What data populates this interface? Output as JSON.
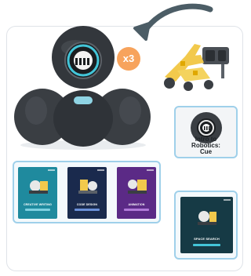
{
  "badge": {
    "text": "x3"
  },
  "intro_card": {
    "label_line1": "Intro to",
    "label_line2": "Robotics:",
    "label_line3": "Cue"
  },
  "book_titles": [
    "CREATIVE WRITING",
    "CODE DESIGN",
    "ANIMATION"
  ],
  "single_book_title": "SPACE SEARCH",
  "colors": {
    "arrow": "#4c5d66",
    "badge": "#f7a35c",
    "card_border": "#9fd0ea",
    "robot_body": "#3b3f44",
    "robot_eye_ring": "#43c5d8"
  }
}
